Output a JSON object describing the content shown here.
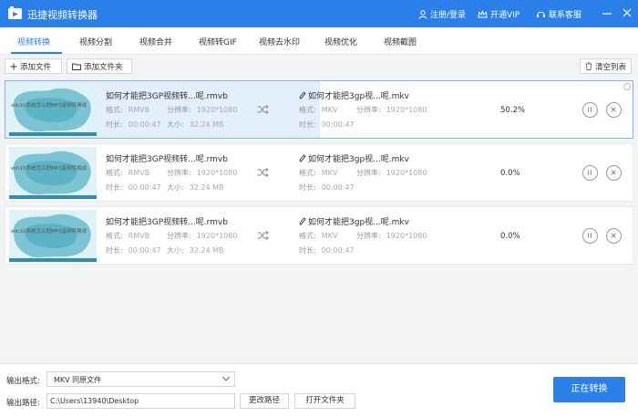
{
  "titlebar": {
    "app_title": "迅捷视频转换器",
    "login": "注册/登录",
    "vip": "开通VIP",
    "service": "联系客服"
  },
  "tabs": [
    {
      "label": "视频转换",
      "active": true
    },
    {
      "label": "视频分割"
    },
    {
      "label": "视频合并"
    },
    {
      "label": "视频转GIF"
    },
    {
      "label": "视频去水印"
    },
    {
      "label": "视频优化"
    },
    {
      "label": "视频截图"
    }
  ],
  "toolbar": {
    "add_file": "添加文件",
    "add_folder": "添加文件夹",
    "clear_list": "清空列表"
  },
  "labels": {
    "format": "格式:",
    "resolution": "分辨率:",
    "duration": "时长:",
    "size": "大小:"
  },
  "files": [
    {
      "thumb_text": "win10系统怎么把MP3音频转换成",
      "src_name": "如何才能把3GP视频转...呢.rmvb",
      "src_format": "RMVB",
      "src_resolution": "1920*1080",
      "src_duration": "00:00:47",
      "src_size": "32.24 MB",
      "dst_name": "如何才能把3gp视...呢.mkv",
      "dst_format": "MKV",
      "dst_resolution": "1920*1080",
      "dst_duration": "00:00:47",
      "progress_text": "50.2%",
      "progress": 50.2,
      "selected": true
    },
    {
      "thumb_text": "win10系统怎么把MP3音频转换成",
      "src_name": "如何才能把3GP视频转...呢.rmvb",
      "src_format": "RMVB",
      "src_resolution": "1920*1080",
      "src_duration": "00:00:47",
      "src_size": "32.24 MB",
      "dst_name": "如何才能把3gp视...呢.mkv",
      "dst_format": "MKV",
      "dst_resolution": "1920*1080",
      "dst_duration": "00:00:47",
      "progress_text": "0.0%",
      "progress": 0
    },
    {
      "thumb_text": "win10系统怎么把MP3音频转换成",
      "src_name": "如何才能把3GP视频转...呢.rmvb",
      "src_format": "RMVB",
      "src_resolution": "1920*1080",
      "src_duration": "00:00:47",
      "src_size": "32.24 MB",
      "dst_name": "如何才能把3gp视...呢.mkv",
      "dst_format": "MKV",
      "dst_resolution": "1920*1080",
      "dst_duration": "00:00:47",
      "progress_text": "0.0%",
      "progress": 0
    }
  ],
  "bottom": {
    "format_label": "输出格式:",
    "format_value": "MKV  同原文件",
    "path_label": "输出路径:",
    "path_value": "C:\\Users\\13940\\Desktop",
    "change_dir": "更改路径",
    "open_folder": "打开文件夹",
    "convert": "正在转换"
  },
  "colors": {
    "accent": "#2b7fe9",
    "progress_fill": "#e3effd"
  }
}
